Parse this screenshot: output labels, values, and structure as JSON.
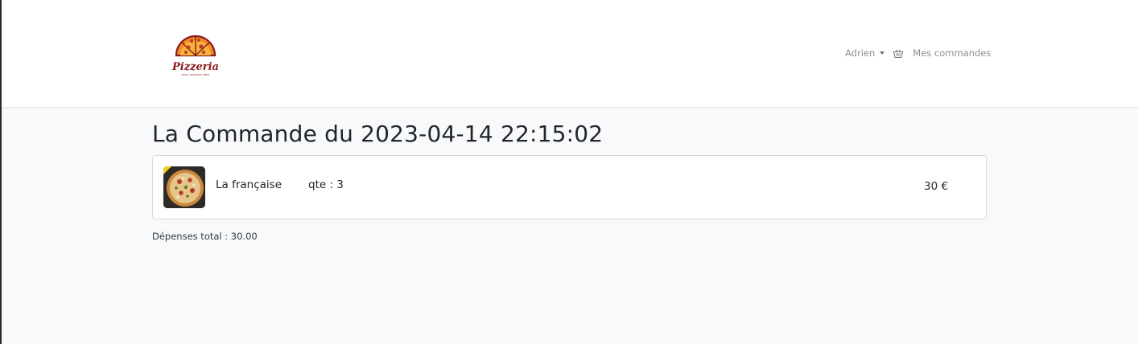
{
  "header": {
    "logo_text": "Pizzeria",
    "logo_tagline": "PIZZA TAKEAWAY HERE",
    "user_name": "Adrien",
    "orders_link": "Mes commandes"
  },
  "order": {
    "title": "La Commande du 2023-04-14 22:15:02",
    "items": [
      {
        "name": "La française",
        "quantity": "qte : 3",
        "price": "30 €"
      }
    ],
    "total": "Dépenses total : 30.00"
  },
  "colors": {
    "navbar_bg": "#ffffff",
    "page_bg": "#f8f9fa",
    "logo_red": "#8b1a1a",
    "logo_orange": "#f08a24",
    "nav_text": "#8a8f96"
  },
  "icons": [
    "pizza-logo-icon",
    "caret-down-icon",
    "basket-icon"
  ]
}
